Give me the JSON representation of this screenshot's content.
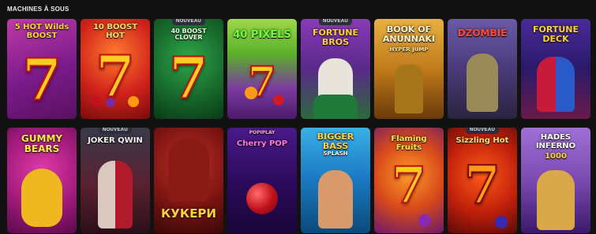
{
  "section": {
    "title": "MACHINES À SOUS"
  },
  "badge_label": "NOUVEAU",
  "games": [
    {
      "name": "5 Hot Wilds Boost",
      "logo": "5 HOT Wilds BOOST",
      "new": false
    },
    {
      "name": "10 Boost Hot",
      "logo": "10 BOOST HOT",
      "new": false
    },
    {
      "name": "40 Boost Clover",
      "logo": "40 BOOST CLOVER",
      "new": true
    },
    {
      "name": "40 Pixels",
      "logo": "40 PIXELS",
      "new": false
    },
    {
      "name": "Fortune Bros",
      "logo": "FORTUNE BROS",
      "new": true
    },
    {
      "name": "Book of Anunnaki Hyper Jump",
      "logo": "BOOK OF ANUNNAKI",
      "sub": "HYPER JUMP",
      "new": false
    },
    {
      "name": "Dzombie",
      "logo": "DZOMBIE",
      "new": false
    },
    {
      "name": "Fortune Deck",
      "logo": "FORTUNE DECK",
      "new": false
    },
    {
      "name": "Gummy Bears",
      "logo": "GUMMY BEARS",
      "new": false
    },
    {
      "name": "Joker Qwin",
      "logo": "JOKER QWIN",
      "new": true
    },
    {
      "name": "Kykepu",
      "logo": "КУКЕРИ",
      "new": false
    },
    {
      "name": "Cherry Pop",
      "logo": "Cherry POP",
      "brand": "POPIPLAY",
      "new": false
    },
    {
      "name": "Bigger Bass Splash",
      "logo": "BIGGER BASS",
      "sub": "SPLASH",
      "new": false
    },
    {
      "name": "Flaming Fruits",
      "logo": "Flaming Fruits",
      "new": false
    },
    {
      "name": "Sizzling Hot",
      "logo": "Sizzling Hot",
      "new": true
    },
    {
      "name": "Hades Inferno 1000",
      "logo": "HADES INFERNO",
      "sub": "1000",
      "new": false
    }
  ],
  "colors": {
    "background": "#121212",
    "badge": "#2a2f3a",
    "title": "#e8e8e8"
  }
}
